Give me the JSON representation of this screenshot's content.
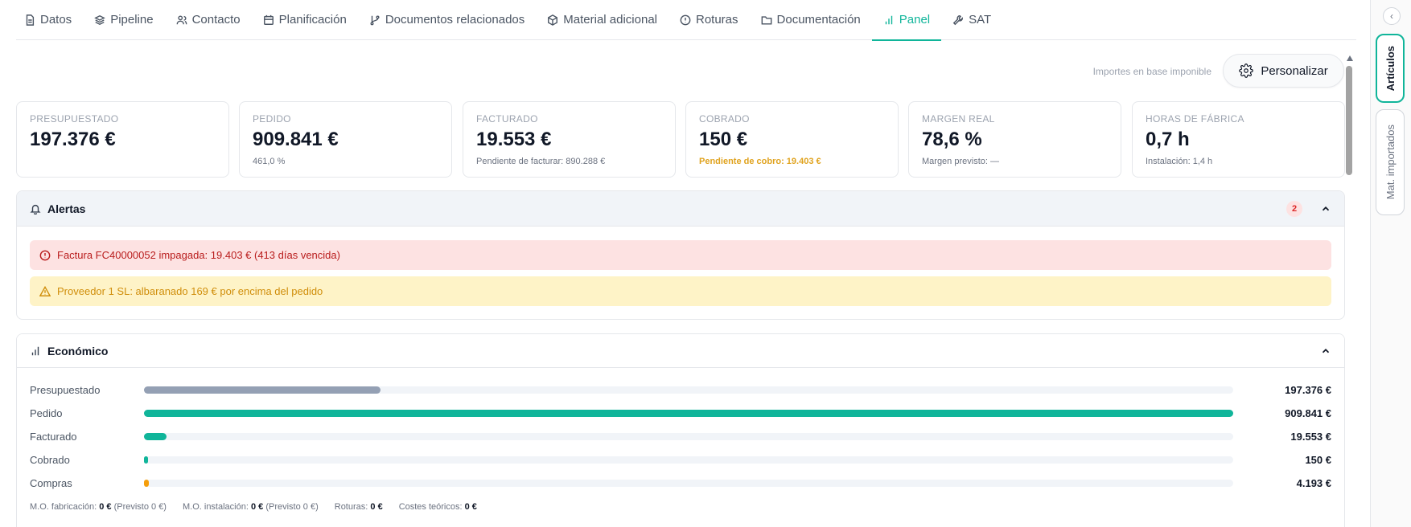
{
  "tabs": [
    {
      "label": "Datos",
      "icon": "document-icon"
    },
    {
      "label": "Pipeline",
      "icon": "layers-icon"
    },
    {
      "label": "Contacto",
      "icon": "users-icon"
    },
    {
      "label": "Planificación",
      "icon": "calendar-icon"
    },
    {
      "label": "Documentos relacionados",
      "icon": "git-branch-icon"
    },
    {
      "label": "Material adicional",
      "icon": "package-icon"
    },
    {
      "label": "Roturas",
      "icon": "alert-circle-icon"
    },
    {
      "label": "Documentación",
      "icon": "folder-icon"
    },
    {
      "label": "Panel",
      "icon": "bar-chart-icon",
      "active": true
    },
    {
      "label": "SAT",
      "icon": "wrench-icon"
    }
  ],
  "toolbar": {
    "imponible_note": "Importes en base imponible",
    "personalizar_label": "Personalizar"
  },
  "kpis": [
    {
      "label": "Presupuestado",
      "value": "197.376 €",
      "sub": ""
    },
    {
      "label": "Pedido",
      "value": "909.841 €",
      "sub": "461,0 %"
    },
    {
      "label": "Facturado",
      "value": "19.553 €",
      "sub": "Pendiente de facturar: 890.288 €"
    },
    {
      "label": "Cobrado",
      "value": "150 €",
      "sub": "Pendiente de cobro: 19.403 €",
      "sub_color": "#e0a31f"
    },
    {
      "label": "Margen real",
      "value": "78,6 %",
      "sub": "Margen previsto: —"
    },
    {
      "label": "Horas de fábrica",
      "value": "0,7 h",
      "sub": "Instalación: 1,4 h"
    }
  ],
  "alerts": {
    "title": "Alertas",
    "count": "2",
    "items": [
      {
        "type": "error",
        "text": "Factura FC40000052 impagada: 19.403 € (413 días vencida)"
      },
      {
        "type": "warning",
        "text": "Proveedor 1 SL: albaranado 169 € por encima del pedido"
      }
    ]
  },
  "economico": {
    "title": "Económico",
    "rows": [
      {
        "label": "Presupuestado",
        "amount": "197.376 €",
        "fraction": 0.217,
        "color": "#94a0b4"
      },
      {
        "label": "Pedido",
        "amount": "909.841 €",
        "fraction": 1.0,
        "color": "#10b59a"
      },
      {
        "label": "Facturado",
        "amount": "19.553 €",
        "fraction": 0.021,
        "color": "#10b59a"
      },
      {
        "label": "Cobrado",
        "amount": "150 €",
        "fraction": 0.0002,
        "color": "#10b59a"
      },
      {
        "label": "Compras",
        "amount": "4.193 €",
        "fraction": 0.0046,
        "color": "#f59e0b"
      }
    ],
    "footer": [
      {
        "label": "M.O. fabricación:",
        "value": "0 €",
        "extra": "(Previsto 0 €)"
      },
      {
        "label": "M.O. instalación:",
        "value": "0 €",
        "extra": "(Previsto 0 €)"
      },
      {
        "label": "Roturas:",
        "value": "0 €",
        "extra": ""
      },
      {
        "label": "Costes teóricos:",
        "value": "0 €",
        "extra": ""
      }
    ]
  },
  "rail": {
    "tab1": "Artículos",
    "tab2": "Mat. importados"
  }
}
